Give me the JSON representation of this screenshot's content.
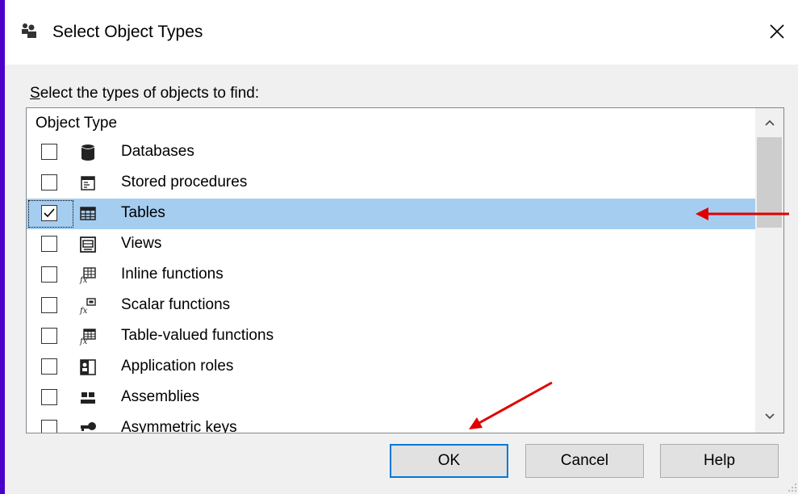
{
  "dialog": {
    "title": "Select Object Types",
    "prompt_underlined": "S",
    "prompt_rest": "elect the types of objects to find:"
  },
  "list": {
    "column_header": "Object Type",
    "items": [
      {
        "label": "Databases",
        "icon": "database-icon",
        "checked": false,
        "selected": false
      },
      {
        "label": "Stored procedures",
        "icon": "stored-procedure-icon",
        "checked": false,
        "selected": false
      },
      {
        "label": "Tables",
        "icon": "table-icon",
        "checked": true,
        "selected": true
      },
      {
        "label": "Views",
        "icon": "view-icon",
        "checked": false,
        "selected": false
      },
      {
        "label": "Inline functions",
        "icon": "inline-function-icon",
        "checked": false,
        "selected": false
      },
      {
        "label": "Scalar functions",
        "icon": "scalar-function-icon",
        "checked": false,
        "selected": false
      },
      {
        "label": "Table-valued functions",
        "icon": "table-valued-function-icon",
        "checked": false,
        "selected": false
      },
      {
        "label": "Application roles",
        "icon": "application-role-icon",
        "checked": false,
        "selected": false
      },
      {
        "label": "Assemblies",
        "icon": "assembly-icon",
        "checked": false,
        "selected": false
      },
      {
        "label": "Asymmetric keys",
        "icon": "asymmetric-key-icon",
        "checked": false,
        "selected": false
      }
    ]
  },
  "buttons": {
    "ok": "OK",
    "cancel": "Cancel",
    "help": "Help"
  },
  "colors": {
    "background": "#4b00c8",
    "selection": "#a5cdf0",
    "default_button_border": "#0078d7",
    "annotation_arrow": "#e00000"
  }
}
